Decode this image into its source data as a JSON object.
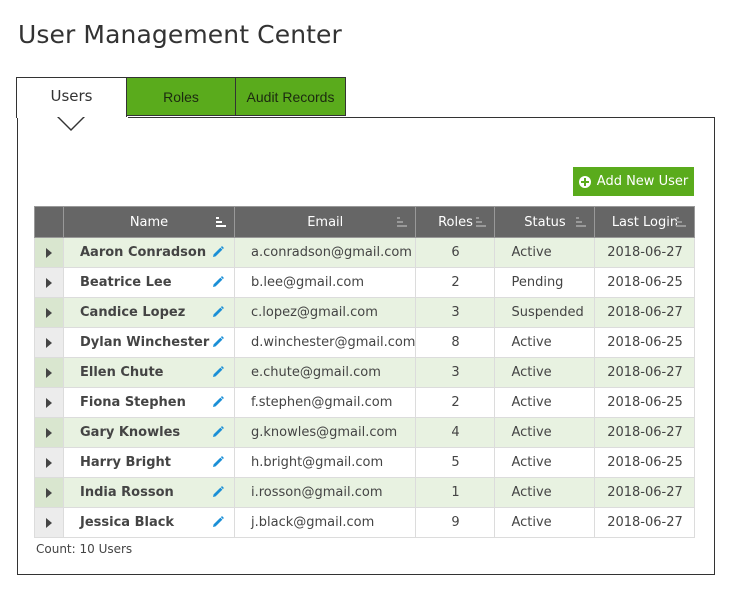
{
  "page": {
    "title": "User Management Center"
  },
  "tabs": [
    {
      "label": "Users",
      "active": true
    },
    {
      "label": "Roles",
      "active": false
    },
    {
      "label": "Audit Records",
      "active": false
    }
  ],
  "toolbar": {
    "add_label": "Add New User",
    "add_icon": "plus-circle-icon"
  },
  "table": {
    "columns": [
      "Name",
      "Email",
      "Roles",
      "Status",
      "Last Login"
    ],
    "rows": [
      {
        "name": "Aaron Conradson",
        "email": "a.conradson@gmail.com",
        "roles": "6",
        "status": "Active",
        "last_login": "2018-06-27"
      },
      {
        "name": "Beatrice Lee",
        "email": "b.lee@gmail.com",
        "roles": "2",
        "status": "Pending",
        "last_login": "2018-06-25"
      },
      {
        "name": "Candice Lopez",
        "email": "c.lopez@gmail.com",
        "roles": "3",
        "status": "Suspended",
        "last_login": "2018-06-27"
      },
      {
        "name": "Dylan Winchester",
        "email": "d.winchester@gmail.com",
        "roles": "8",
        "status": "Active",
        "last_login": "2018-06-25"
      },
      {
        "name": "Ellen Chute",
        "email": "e.chute@gmail.com",
        "roles": "3",
        "status": "Active",
        "last_login": "2018-06-27"
      },
      {
        "name": "Fiona Stephen",
        "email": "f.stephen@gmail.com",
        "roles": "2",
        "status": "Active",
        "last_login": "2018-06-25"
      },
      {
        "name": "Gary Knowles",
        "email": "g.knowles@gmail.com",
        "roles": "4",
        "status": "Active",
        "last_login": "2018-06-27"
      },
      {
        "name": "Harry Bright",
        "email": "h.bright@gmail.com",
        "roles": "5",
        "status": "Active",
        "last_login": "2018-06-25"
      },
      {
        "name": "India Rosson",
        "email": "i.rosson@gmail.com",
        "roles": "1",
        "status": "Active",
        "last_login": "2018-06-27"
      },
      {
        "name": "Jessica Black",
        "email": "j.black@gmail.com",
        "roles": "9",
        "status": "Active",
        "last_login": "2018-06-27"
      }
    ]
  },
  "footer": {
    "count": "Count: 10 Users"
  },
  "colors": {
    "accent": "#5aab1c",
    "header_bg": "#666666",
    "row_alt": "#e8f2e1",
    "edit_icon": "#1a8fd6"
  }
}
